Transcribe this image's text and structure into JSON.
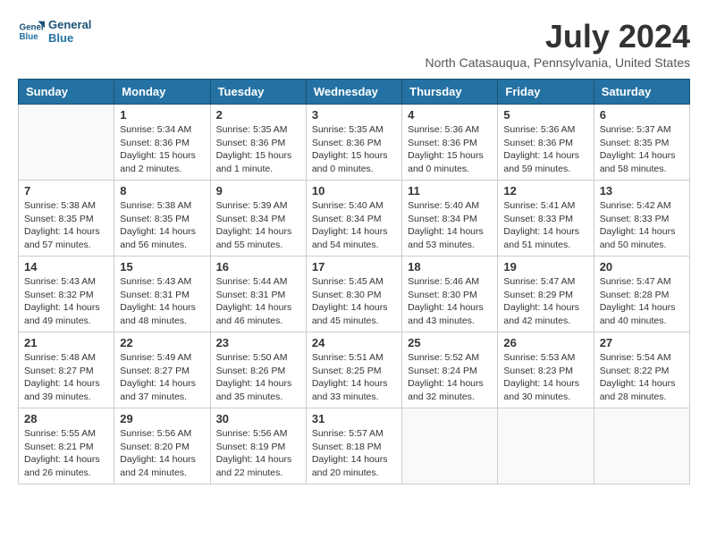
{
  "header": {
    "logo_line1": "General",
    "logo_line2": "Blue",
    "month_year": "July 2024",
    "location": "North Catasauqua, Pennsylvania, United States"
  },
  "columns": [
    "Sunday",
    "Monday",
    "Tuesday",
    "Wednesday",
    "Thursday",
    "Friday",
    "Saturday"
  ],
  "weeks": [
    [
      {
        "day": "",
        "info": ""
      },
      {
        "day": "1",
        "info": "Sunrise: 5:34 AM\nSunset: 8:36 PM\nDaylight: 15 hours\nand 2 minutes."
      },
      {
        "day": "2",
        "info": "Sunrise: 5:35 AM\nSunset: 8:36 PM\nDaylight: 15 hours\nand 1 minute."
      },
      {
        "day": "3",
        "info": "Sunrise: 5:35 AM\nSunset: 8:36 PM\nDaylight: 15 hours\nand 0 minutes."
      },
      {
        "day": "4",
        "info": "Sunrise: 5:36 AM\nSunset: 8:36 PM\nDaylight: 15 hours\nand 0 minutes."
      },
      {
        "day": "5",
        "info": "Sunrise: 5:36 AM\nSunset: 8:36 PM\nDaylight: 14 hours\nand 59 minutes."
      },
      {
        "day": "6",
        "info": "Sunrise: 5:37 AM\nSunset: 8:35 PM\nDaylight: 14 hours\nand 58 minutes."
      }
    ],
    [
      {
        "day": "7",
        "info": "Sunrise: 5:38 AM\nSunset: 8:35 PM\nDaylight: 14 hours\nand 57 minutes."
      },
      {
        "day": "8",
        "info": "Sunrise: 5:38 AM\nSunset: 8:35 PM\nDaylight: 14 hours\nand 56 minutes."
      },
      {
        "day": "9",
        "info": "Sunrise: 5:39 AM\nSunset: 8:34 PM\nDaylight: 14 hours\nand 55 minutes."
      },
      {
        "day": "10",
        "info": "Sunrise: 5:40 AM\nSunset: 8:34 PM\nDaylight: 14 hours\nand 54 minutes."
      },
      {
        "day": "11",
        "info": "Sunrise: 5:40 AM\nSunset: 8:34 PM\nDaylight: 14 hours\nand 53 minutes."
      },
      {
        "day": "12",
        "info": "Sunrise: 5:41 AM\nSunset: 8:33 PM\nDaylight: 14 hours\nand 51 minutes."
      },
      {
        "day": "13",
        "info": "Sunrise: 5:42 AM\nSunset: 8:33 PM\nDaylight: 14 hours\nand 50 minutes."
      }
    ],
    [
      {
        "day": "14",
        "info": "Sunrise: 5:43 AM\nSunset: 8:32 PM\nDaylight: 14 hours\nand 49 minutes."
      },
      {
        "day": "15",
        "info": "Sunrise: 5:43 AM\nSunset: 8:31 PM\nDaylight: 14 hours\nand 48 minutes."
      },
      {
        "day": "16",
        "info": "Sunrise: 5:44 AM\nSunset: 8:31 PM\nDaylight: 14 hours\nand 46 minutes."
      },
      {
        "day": "17",
        "info": "Sunrise: 5:45 AM\nSunset: 8:30 PM\nDaylight: 14 hours\nand 45 minutes."
      },
      {
        "day": "18",
        "info": "Sunrise: 5:46 AM\nSunset: 8:30 PM\nDaylight: 14 hours\nand 43 minutes."
      },
      {
        "day": "19",
        "info": "Sunrise: 5:47 AM\nSunset: 8:29 PM\nDaylight: 14 hours\nand 42 minutes."
      },
      {
        "day": "20",
        "info": "Sunrise: 5:47 AM\nSunset: 8:28 PM\nDaylight: 14 hours\nand 40 minutes."
      }
    ],
    [
      {
        "day": "21",
        "info": "Sunrise: 5:48 AM\nSunset: 8:27 PM\nDaylight: 14 hours\nand 39 minutes."
      },
      {
        "day": "22",
        "info": "Sunrise: 5:49 AM\nSunset: 8:27 PM\nDaylight: 14 hours\nand 37 minutes."
      },
      {
        "day": "23",
        "info": "Sunrise: 5:50 AM\nSunset: 8:26 PM\nDaylight: 14 hours\nand 35 minutes."
      },
      {
        "day": "24",
        "info": "Sunrise: 5:51 AM\nSunset: 8:25 PM\nDaylight: 14 hours\nand 33 minutes."
      },
      {
        "day": "25",
        "info": "Sunrise: 5:52 AM\nSunset: 8:24 PM\nDaylight: 14 hours\nand 32 minutes."
      },
      {
        "day": "26",
        "info": "Sunrise: 5:53 AM\nSunset: 8:23 PM\nDaylight: 14 hours\nand 30 minutes."
      },
      {
        "day": "27",
        "info": "Sunrise: 5:54 AM\nSunset: 8:22 PM\nDaylight: 14 hours\nand 28 minutes."
      }
    ],
    [
      {
        "day": "28",
        "info": "Sunrise: 5:55 AM\nSunset: 8:21 PM\nDaylight: 14 hours\nand 26 minutes."
      },
      {
        "day": "29",
        "info": "Sunrise: 5:56 AM\nSunset: 8:20 PM\nDaylight: 14 hours\nand 24 minutes."
      },
      {
        "day": "30",
        "info": "Sunrise: 5:56 AM\nSunset: 8:19 PM\nDaylight: 14 hours\nand 22 minutes."
      },
      {
        "day": "31",
        "info": "Sunrise: 5:57 AM\nSunset: 8:18 PM\nDaylight: 14 hours\nand 20 minutes."
      },
      {
        "day": "",
        "info": ""
      },
      {
        "day": "",
        "info": ""
      },
      {
        "day": "",
        "info": ""
      }
    ]
  ]
}
